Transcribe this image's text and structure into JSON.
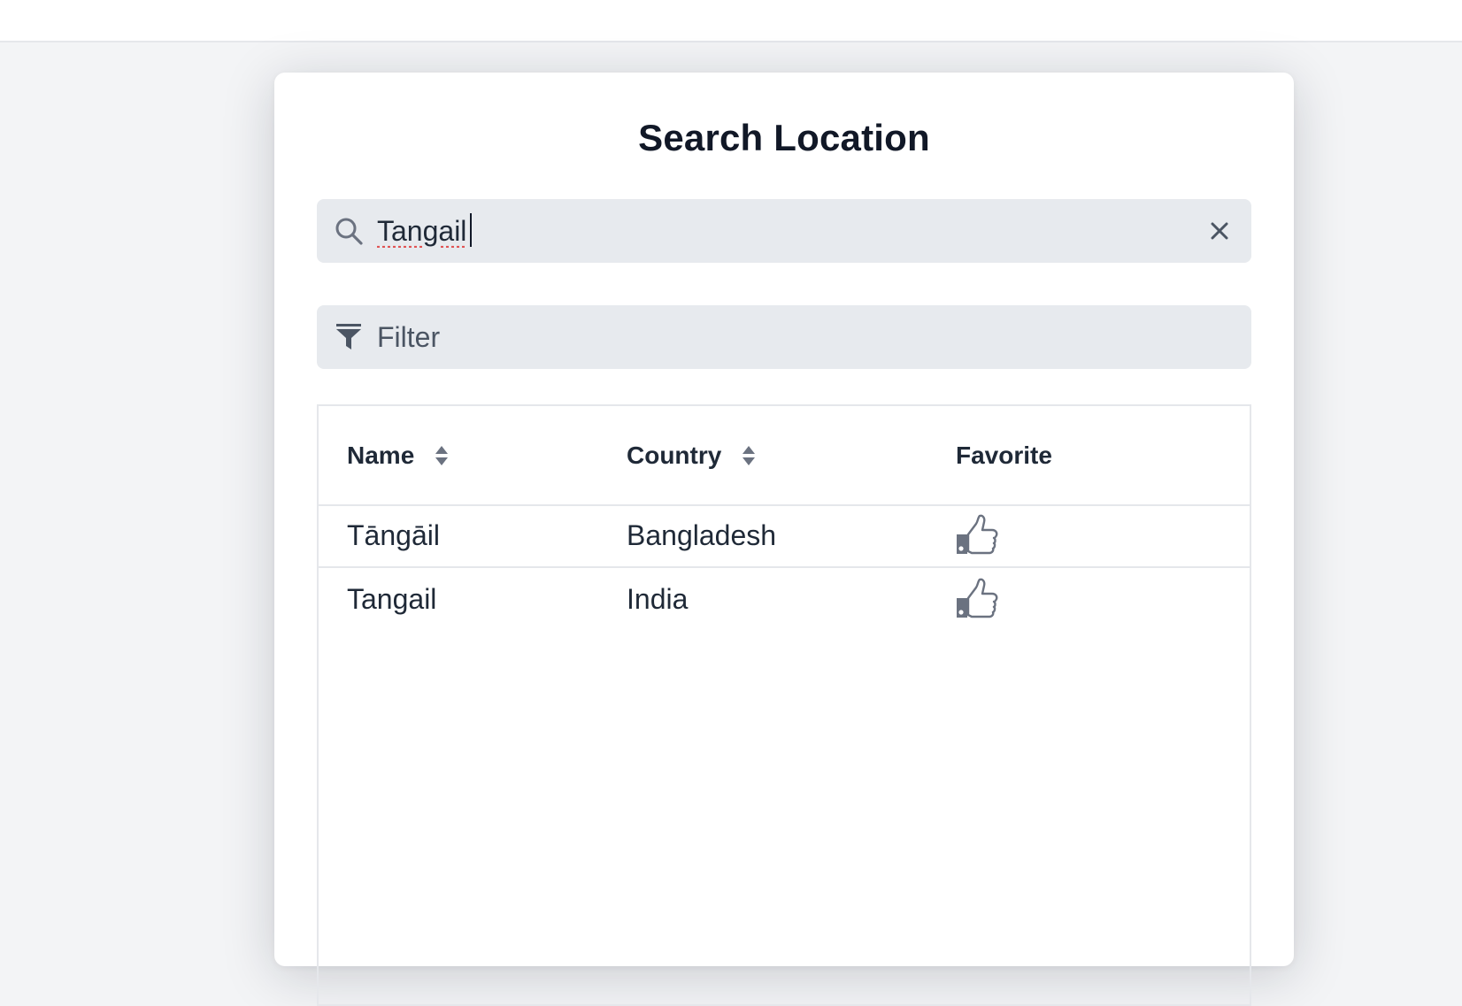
{
  "dialog": {
    "title": "Search Location"
  },
  "search": {
    "value": "Tangail",
    "icon": "search-icon",
    "clear_icon": "close-icon"
  },
  "filter": {
    "label": "Filter",
    "icon": "filter-icon"
  },
  "table": {
    "columns": [
      {
        "label": "Name",
        "sortable": true
      },
      {
        "label": "Country",
        "sortable": true
      },
      {
        "label": "Favorite",
        "sortable": false
      }
    ],
    "rows": [
      {
        "name": "Tāngāil",
        "country": "Bangladesh",
        "favorite_icon": "thumbs-up-icon"
      },
      {
        "name": "Tangail",
        "country": "India",
        "favorite_icon": "thumbs-up-icon"
      }
    ]
  },
  "colors": {
    "page_background": "#f3f4f6",
    "input_background": "#e7eaee",
    "icon_gray": "#6b7280",
    "text_dark": "#111827"
  }
}
